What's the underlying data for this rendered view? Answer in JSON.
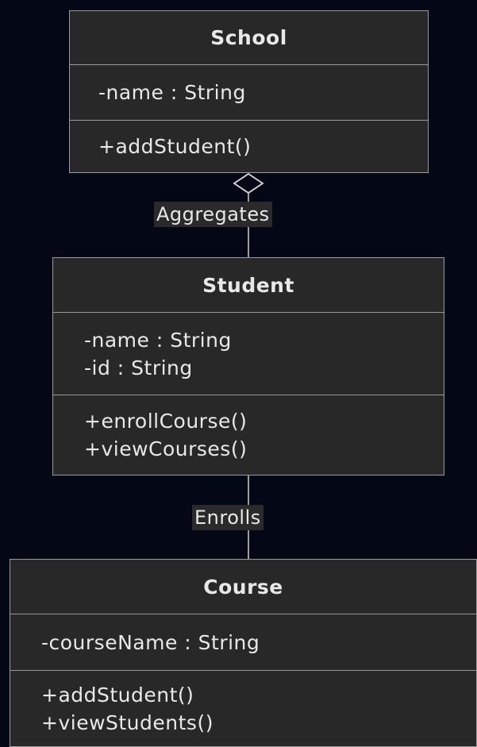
{
  "classes": {
    "school": {
      "name": "School",
      "attributes": [
        "-name : String"
      ],
      "methods": [
        "+addStudent()"
      ]
    },
    "student": {
      "name": "Student",
      "attributes": [
        "-name : String",
        "-id : String"
      ],
      "methods": [
        "+enrollCourse()",
        "+viewCourses()"
      ]
    },
    "course": {
      "name": "Course",
      "attributes": [
        "-courseName : String"
      ],
      "methods": [
        "+addStudent()",
        "+viewStudents()"
      ]
    }
  },
  "relations": {
    "school_student": {
      "label": "Aggregates",
      "type": "aggregation"
    },
    "student_course": {
      "label": "Enrolls",
      "type": "association"
    }
  },
  "colors": {
    "background": "#040816",
    "box_fill": "#282828",
    "box_border": "#9a9a9a",
    "text": "#e8e8e8",
    "label_fill": "#2a2a2a"
  }
}
